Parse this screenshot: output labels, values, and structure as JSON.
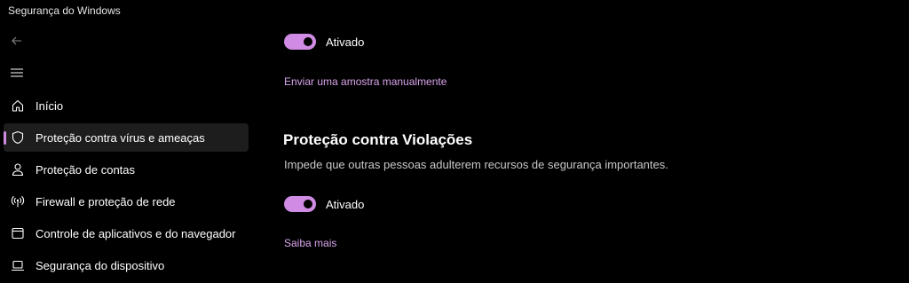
{
  "app": {
    "title": "Segurança do Windows"
  },
  "navigation": {
    "back_icon": "back-arrow-icon",
    "menu_icon": "hamburger-menu-icon",
    "items": [
      {
        "label": "Início",
        "icon": "home-icon",
        "selected": false
      },
      {
        "label": "Proteção contra vírus e ameaças",
        "icon": "shield-icon",
        "selected": true
      },
      {
        "label": "Proteção de contas",
        "icon": "person-icon",
        "selected": false
      },
      {
        "label": "Firewall e proteção de rede",
        "icon": "antenna-icon",
        "selected": false
      },
      {
        "label": "Controle de aplicativos e do navegador",
        "icon": "browser-window-icon",
        "selected": false
      },
      {
        "label": "Segurança do dispositivo",
        "icon": "laptop-icon",
        "selected": false
      }
    ]
  },
  "content": {
    "sample_toggle": {
      "state": "on",
      "label": "Ativado"
    },
    "submit_sample_link": "Enviar uma amostra manualmente",
    "tamper_protection": {
      "title": "Proteção contra Violações",
      "description": "Impede que outras pessoas adulterem recursos de segurança importantes.",
      "toggle": {
        "state": "on",
        "label": "Ativado"
      },
      "learn_more_link": "Saiba mais"
    }
  },
  "colors": {
    "background": "#000000",
    "accent": "#d08be5",
    "link": "#d9a4ec",
    "selected_item_bg": "#1d1d1d"
  }
}
